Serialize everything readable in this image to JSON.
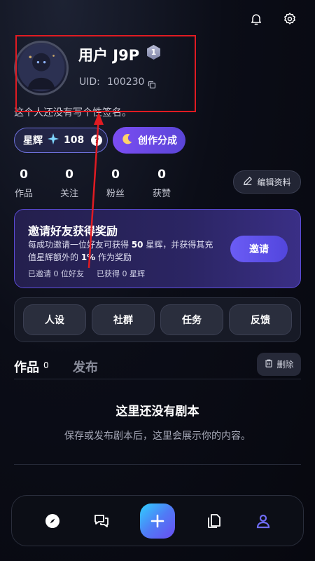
{
  "profile": {
    "username": "用户 J9P",
    "level": "1",
    "uid_label": "UID:",
    "uid_value": "100230",
    "signature": "这个人还没有写个性签名。"
  },
  "chips": {
    "star_label": "星辉",
    "star_value": "108",
    "help": "?",
    "create_label": "创作分成"
  },
  "stats": [
    {
      "value": "0",
      "label": "作品"
    },
    {
      "value": "0",
      "label": "关注"
    },
    {
      "value": "0",
      "label": "粉丝"
    },
    {
      "value": "0",
      "label": "获赞"
    }
  ],
  "edit_profile_label": "编辑资料",
  "invite": {
    "title": "邀请好友获得奖励",
    "desc_part1": "每成功邀请一位好友可获得 ",
    "desc_bold1": "50",
    "desc_part2": " 星辉，并获得其充值星辉额外的 ",
    "desc_bold2": "1%",
    "desc_part3": " 作为奖励",
    "invited": "已邀请 0 位好友",
    "earned": "已获得 0 星辉",
    "button": "邀请"
  },
  "quick_buttons": [
    "人设",
    "社群",
    "任务",
    "反馈"
  ],
  "tabs": {
    "active_label": "作品",
    "active_count": "0",
    "inactive_label": "发布",
    "delete_label": "删除"
  },
  "empty": {
    "title": "这里还没有剧本",
    "desc": "保存或发布剧本后，这里会展示你的内容。"
  },
  "nav": {
    "items": [
      "compass-icon",
      "chat-icon",
      "plus-icon",
      "pages-icon",
      "user-icon"
    ],
    "active": "user-icon",
    "active_color": "#6f6cf6"
  },
  "colors": {
    "accent": "#6b5cf5",
    "annotation": "#e01b22"
  }
}
